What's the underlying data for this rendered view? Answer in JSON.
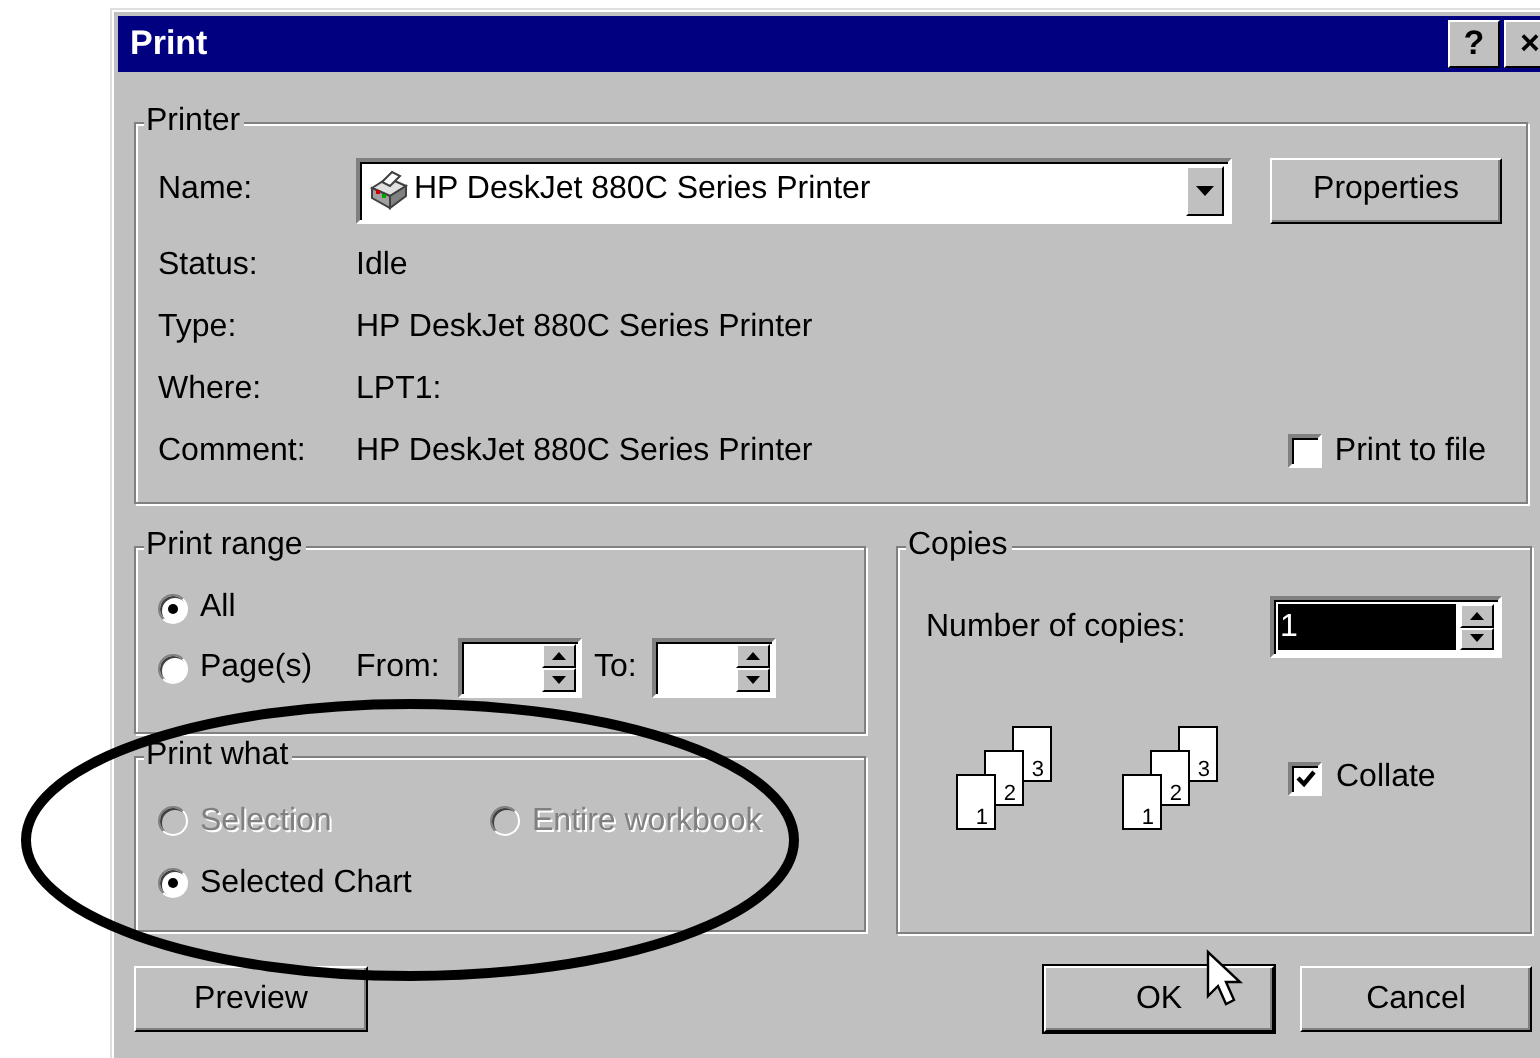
{
  "window": {
    "title": "Print",
    "title_buttons": [
      "?",
      "×"
    ]
  },
  "printer": {
    "legend": "Printer",
    "name_label": "Name:",
    "name_value": "HP DeskJet 880C Series Printer",
    "properties_button": "Properties",
    "details": [
      {
        "label": "Status:",
        "value": "Idle"
      },
      {
        "label": "Type:",
        "value": "HP DeskJet 880C Series Printer"
      },
      {
        "label": "Where:",
        "value": "LPT1:"
      },
      {
        "label": "Comment:",
        "value": "HP DeskJet 880C Series Printer"
      }
    ],
    "print_to_file": {
      "label": "Print to file",
      "checked": false
    }
  },
  "print_range": {
    "legend": "Print range",
    "options": [
      {
        "label": "All",
        "selected": true
      },
      {
        "label": "Page(s)",
        "selected": false
      }
    ],
    "from_label": "From:",
    "to_label": "To:"
  },
  "print_what": {
    "legend": "Print what",
    "options": [
      {
        "label": "Selection",
        "selected": false,
        "disabled": true
      },
      {
        "label": "Entire workbook",
        "selected": false,
        "disabled": true
      },
      {
        "label": "Selected Chart",
        "selected": true,
        "disabled": false
      }
    ]
  },
  "copies": {
    "legend": "Copies",
    "count_label": "Number of copies:",
    "count_value": "1",
    "count_highlighted": true,
    "collate_stacks": [
      {
        "pages": [
          "1",
          "2",
          "3"
        ]
      },
      {
        "pages": [
          "1",
          "2",
          "3"
        ]
      }
    ],
    "collate": {
      "label": "Collate",
      "checked": true
    }
  },
  "buttons": [
    {
      "label": "Preview",
      "default": false
    },
    {
      "label": "OK",
      "default": true
    },
    {
      "label": "Cancel",
      "default": false
    }
  ],
  "annotations": [
    {
      "kind": "ellipse"
    }
  ]
}
